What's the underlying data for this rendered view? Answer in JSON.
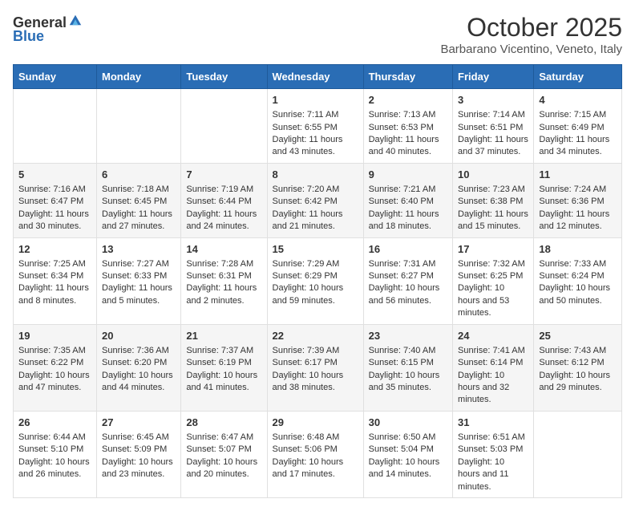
{
  "logo": {
    "general": "General",
    "blue": "Blue"
  },
  "title": "October 2025",
  "subtitle": "Barbarano Vicentino, Veneto, Italy",
  "headers": [
    "Sunday",
    "Monday",
    "Tuesday",
    "Wednesday",
    "Thursday",
    "Friday",
    "Saturday"
  ],
  "weeks": [
    [
      {
        "day": "",
        "info": ""
      },
      {
        "day": "",
        "info": ""
      },
      {
        "day": "",
        "info": ""
      },
      {
        "day": "1",
        "info": "Sunrise: 7:11 AM\nSunset: 6:55 PM\nDaylight: 11 hours and 43 minutes."
      },
      {
        "day": "2",
        "info": "Sunrise: 7:13 AM\nSunset: 6:53 PM\nDaylight: 11 hours and 40 minutes."
      },
      {
        "day": "3",
        "info": "Sunrise: 7:14 AM\nSunset: 6:51 PM\nDaylight: 11 hours and 37 minutes."
      },
      {
        "day": "4",
        "info": "Sunrise: 7:15 AM\nSunset: 6:49 PM\nDaylight: 11 hours and 34 minutes."
      }
    ],
    [
      {
        "day": "5",
        "info": "Sunrise: 7:16 AM\nSunset: 6:47 PM\nDaylight: 11 hours and 30 minutes."
      },
      {
        "day": "6",
        "info": "Sunrise: 7:18 AM\nSunset: 6:45 PM\nDaylight: 11 hours and 27 minutes."
      },
      {
        "day": "7",
        "info": "Sunrise: 7:19 AM\nSunset: 6:44 PM\nDaylight: 11 hours and 24 minutes."
      },
      {
        "day": "8",
        "info": "Sunrise: 7:20 AM\nSunset: 6:42 PM\nDaylight: 11 hours and 21 minutes."
      },
      {
        "day": "9",
        "info": "Sunrise: 7:21 AM\nSunset: 6:40 PM\nDaylight: 11 hours and 18 minutes."
      },
      {
        "day": "10",
        "info": "Sunrise: 7:23 AM\nSunset: 6:38 PM\nDaylight: 11 hours and 15 minutes."
      },
      {
        "day": "11",
        "info": "Sunrise: 7:24 AM\nSunset: 6:36 PM\nDaylight: 11 hours and 12 minutes."
      }
    ],
    [
      {
        "day": "12",
        "info": "Sunrise: 7:25 AM\nSunset: 6:34 PM\nDaylight: 11 hours and 8 minutes."
      },
      {
        "day": "13",
        "info": "Sunrise: 7:27 AM\nSunset: 6:33 PM\nDaylight: 11 hours and 5 minutes."
      },
      {
        "day": "14",
        "info": "Sunrise: 7:28 AM\nSunset: 6:31 PM\nDaylight: 11 hours and 2 minutes."
      },
      {
        "day": "15",
        "info": "Sunrise: 7:29 AM\nSunset: 6:29 PM\nDaylight: 10 hours and 59 minutes."
      },
      {
        "day": "16",
        "info": "Sunrise: 7:31 AM\nSunset: 6:27 PM\nDaylight: 10 hours and 56 minutes."
      },
      {
        "day": "17",
        "info": "Sunrise: 7:32 AM\nSunset: 6:25 PM\nDaylight: 10 hours and 53 minutes."
      },
      {
        "day": "18",
        "info": "Sunrise: 7:33 AM\nSunset: 6:24 PM\nDaylight: 10 hours and 50 minutes."
      }
    ],
    [
      {
        "day": "19",
        "info": "Sunrise: 7:35 AM\nSunset: 6:22 PM\nDaylight: 10 hours and 47 minutes."
      },
      {
        "day": "20",
        "info": "Sunrise: 7:36 AM\nSunset: 6:20 PM\nDaylight: 10 hours and 44 minutes."
      },
      {
        "day": "21",
        "info": "Sunrise: 7:37 AM\nSunset: 6:19 PM\nDaylight: 10 hours and 41 minutes."
      },
      {
        "day": "22",
        "info": "Sunrise: 7:39 AM\nSunset: 6:17 PM\nDaylight: 10 hours and 38 minutes."
      },
      {
        "day": "23",
        "info": "Sunrise: 7:40 AM\nSunset: 6:15 PM\nDaylight: 10 hours and 35 minutes."
      },
      {
        "day": "24",
        "info": "Sunrise: 7:41 AM\nSunset: 6:14 PM\nDaylight: 10 hours and 32 minutes."
      },
      {
        "day": "25",
        "info": "Sunrise: 7:43 AM\nSunset: 6:12 PM\nDaylight: 10 hours and 29 minutes."
      }
    ],
    [
      {
        "day": "26",
        "info": "Sunrise: 6:44 AM\nSunset: 5:10 PM\nDaylight: 10 hours and 26 minutes."
      },
      {
        "day": "27",
        "info": "Sunrise: 6:45 AM\nSunset: 5:09 PM\nDaylight: 10 hours and 23 minutes."
      },
      {
        "day": "28",
        "info": "Sunrise: 6:47 AM\nSunset: 5:07 PM\nDaylight: 10 hours and 20 minutes."
      },
      {
        "day": "29",
        "info": "Sunrise: 6:48 AM\nSunset: 5:06 PM\nDaylight: 10 hours and 17 minutes."
      },
      {
        "day": "30",
        "info": "Sunrise: 6:50 AM\nSunset: 5:04 PM\nDaylight: 10 hours and 14 minutes."
      },
      {
        "day": "31",
        "info": "Sunrise: 6:51 AM\nSunset: 5:03 PM\nDaylight: 10 hours and 11 minutes."
      },
      {
        "day": "",
        "info": ""
      }
    ]
  ]
}
